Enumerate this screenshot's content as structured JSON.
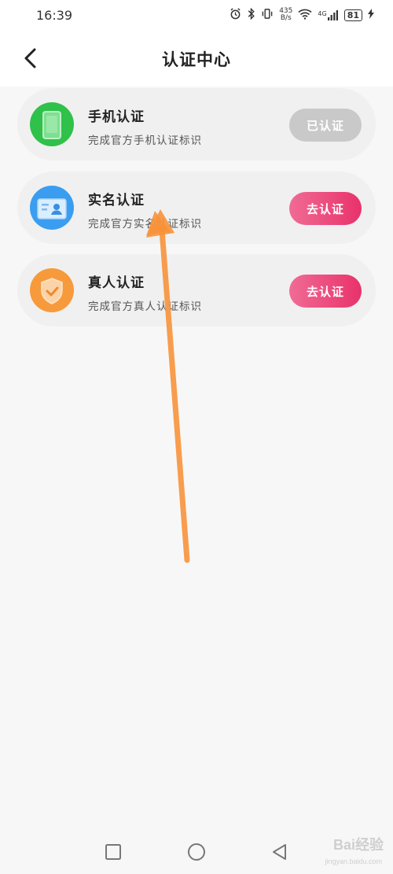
{
  "status_bar": {
    "time": "16:39",
    "net_speed_value": "435",
    "net_speed_unit": "B/s",
    "battery": "81",
    "network": "4G"
  },
  "header": {
    "title": "认证中心",
    "back_icon": "chevron-left-icon"
  },
  "cards": [
    {
      "title": "手机认证",
      "desc": "完成官方手机认证标识",
      "button": "已认证",
      "status": "done",
      "icon": "phone-icon",
      "icon_color": "#2fc14a"
    },
    {
      "title": "实名认证",
      "desc": "完成官方实名认证标识",
      "button": "去认证",
      "status": "pending",
      "icon": "id-card-icon",
      "icon_color": "#3a9df0"
    },
    {
      "title": "真人认证",
      "desc": "完成官方真人认证标识",
      "button": "去认证",
      "status": "pending",
      "icon": "shield-check-icon",
      "icon_color": "#f79a3c"
    }
  ],
  "colors": {
    "accent_pink": "#e8326b",
    "done_gray": "#c9c9c9",
    "annotation_arrow": "#f7923a"
  },
  "watermark": {
    "text": "Bai经验",
    "sub": "jingyan.baidu.com"
  }
}
